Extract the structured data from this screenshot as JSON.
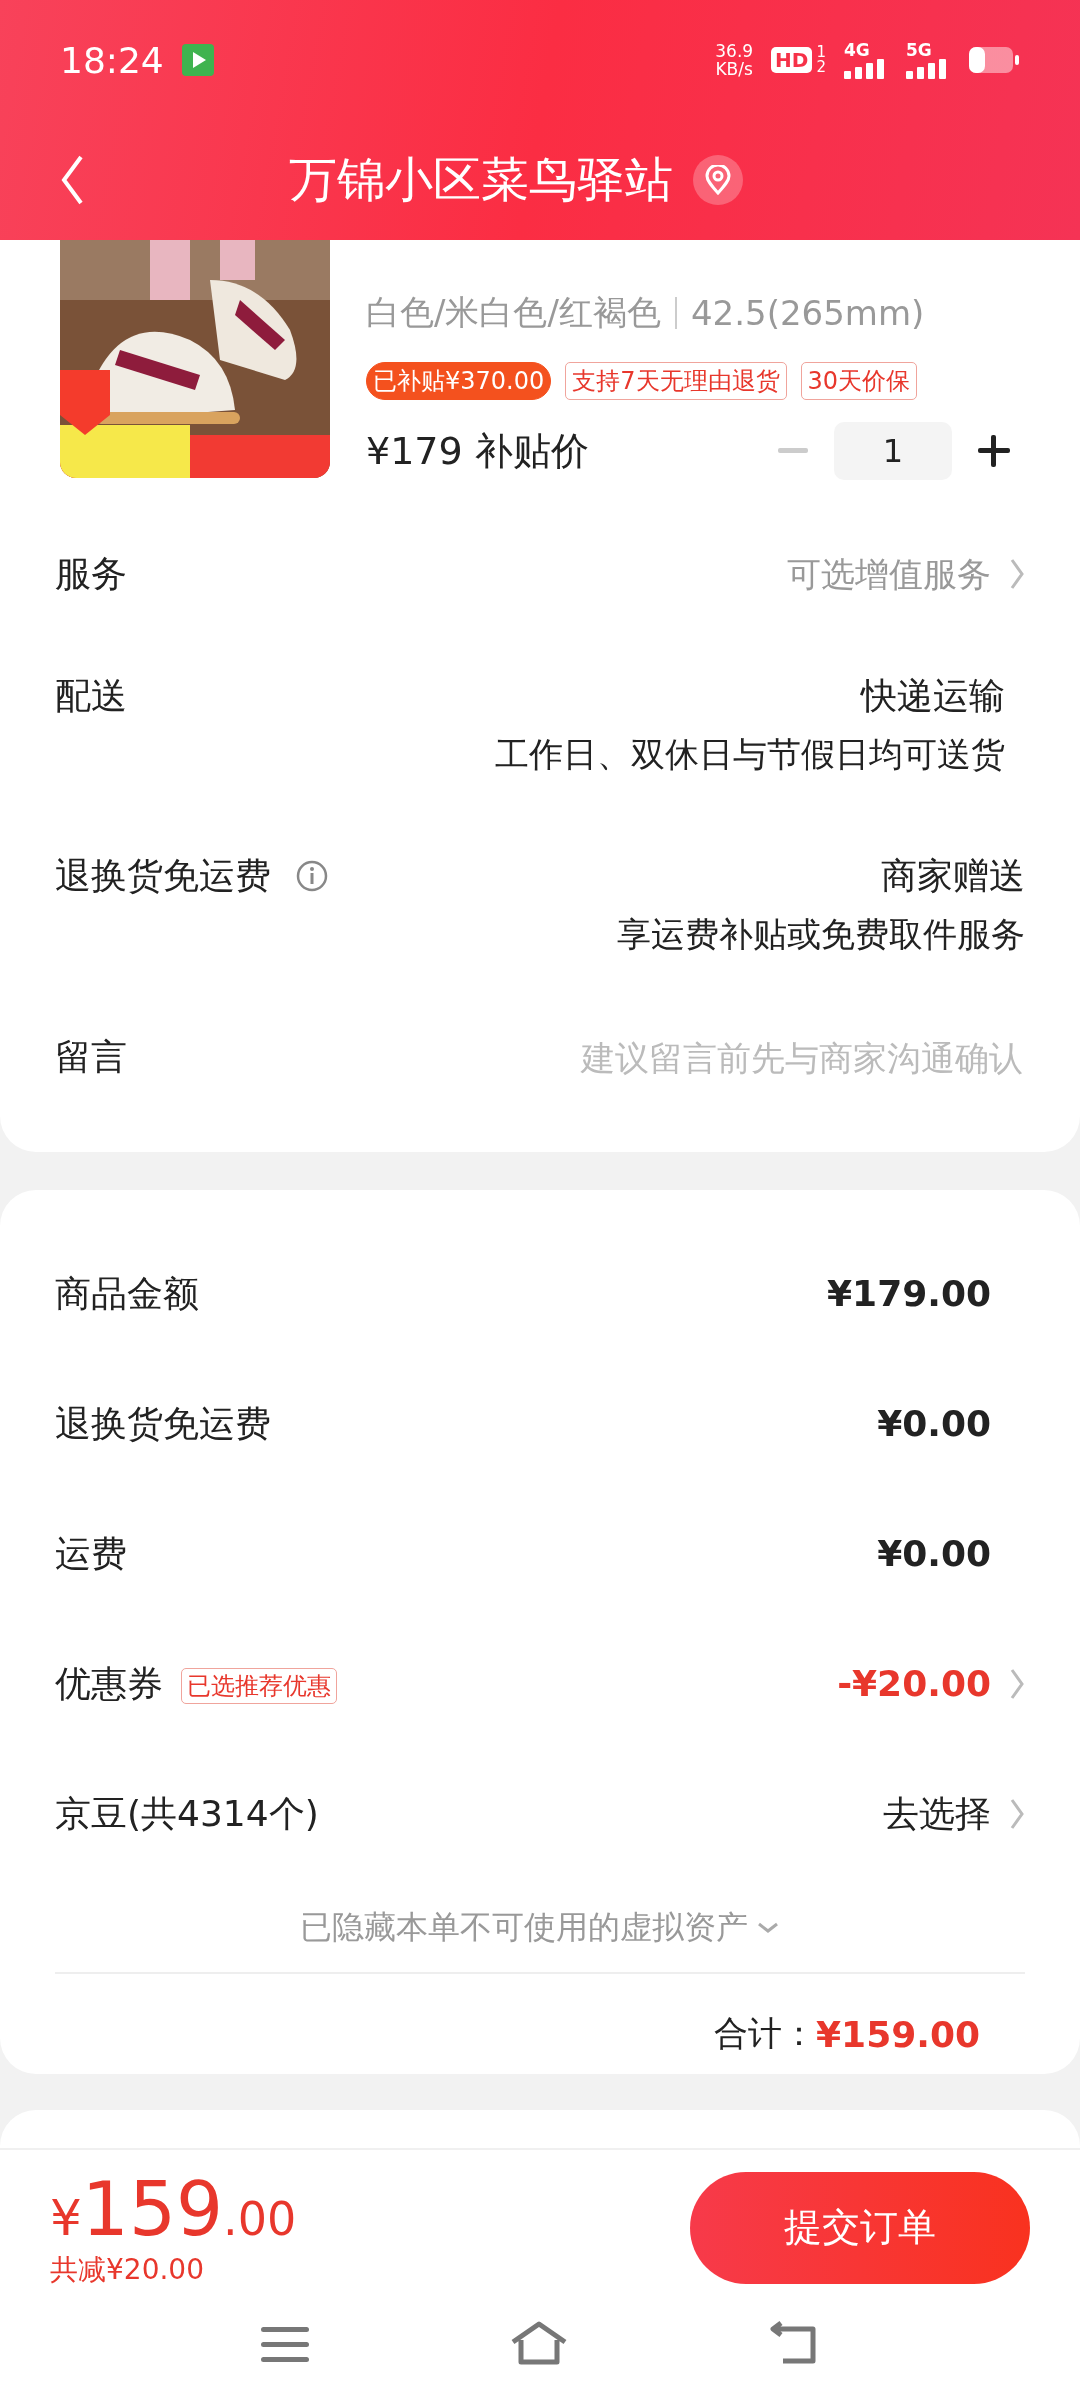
{
  "status_bar": {
    "time": "18:24",
    "speed_value": "36.9",
    "speed_unit": "KB/s",
    "hd": "HD",
    "hd_sup": "1",
    "hd_sub": "2",
    "network_1": "4G",
    "network_2": "5G"
  },
  "header": {
    "title": "万锦小区菜鸟驿站"
  },
  "product": {
    "variant": "白色/米白色/红褐色",
    "size": "42.5(265mm)",
    "price": "¥179",
    "price_label": "补贴价",
    "quantity": "1",
    "tags": [
      {
        "text": "已补贴¥370.00",
        "kind": "filled"
      },
      {
        "text": "支持7天无理由退货",
        "kind": "outline"
      },
      {
        "text": "30天价保",
        "kind": "outline"
      }
    ]
  },
  "order_rows": [
    {
      "kind": "link",
      "label": "服务",
      "value": "可选增值服务"
    },
    {
      "kind": "text",
      "label": "配送",
      "value": "快递运输",
      "subvalue": "工作日、双休日与节假日均可送货"
    },
    {
      "kind": "info",
      "label": "退换货免运费",
      "value": "商家赠送",
      "subvalue": "享运费补贴或免费取件服务"
    },
    {
      "kind": "input",
      "label": "留言",
      "placeholder": "建议留言前先与商家沟通确认"
    }
  ],
  "summary_rows": [
    {
      "label": "商品金额",
      "value": "¥179.00",
      "kind": "amount",
      "chevron": false
    },
    {
      "label": "退换货免运费",
      "value": "¥0.00",
      "kind": "amount",
      "chevron": false
    },
    {
      "label": "运费",
      "value": "¥0.00",
      "kind": "amount",
      "chevron": false
    },
    {
      "label": "优惠券",
      "tag": "已选推荐优惠",
      "value": "-¥20.00",
      "kind": "discount",
      "chevron": true
    },
    {
      "label": "京豆(共4314个)",
      "value": "去选择",
      "kind": "action",
      "chevron": true
    }
  ],
  "hidden_note": "已隐藏本单不可使用的虚拟资产",
  "total": {
    "label": "合计：",
    "value": "¥159.00"
  },
  "bottom_bar": {
    "currency": "¥",
    "integer": "159",
    "decimal": ".00",
    "saving": "共减¥20.00",
    "submit": "提交订单"
  }
}
